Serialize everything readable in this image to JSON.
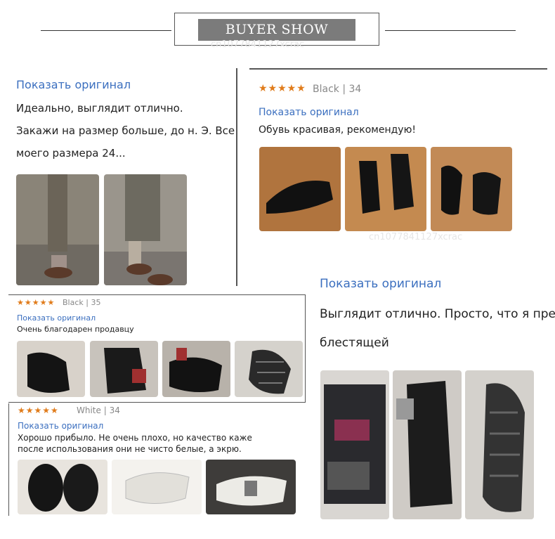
{
  "header": {
    "title": "BUYER SHOW",
    "watermark": "cn1077841127xcrac"
  },
  "review1": {
    "link": "Показать оригинал",
    "line1": "Идеально, выглядит отлично.",
    "line2": "Закажи на размер больше, до н. Э. Все гов",
    "line3": "моего размера 24..."
  },
  "review2": {
    "stars": "★★★★★",
    "meta": "Black | 34",
    "link": "Показать оригинал",
    "text": "Обувь красивая, рекомендую!"
  },
  "review3": {
    "stars": "★★★★★",
    "meta": "Black | 35",
    "link": "Показать оригинал",
    "text": "Очень благодарен продавцу"
  },
  "review4": {
    "stars": "★★★★★",
    "meta": "White | 34",
    "link": "Показать оригинал",
    "line1": "Хорошо прибыло. Не очень плохо, но качество каже",
    "line2": "после использования они не чисто белые, а экрю."
  },
  "review5": {
    "link": "Показать оригинал",
    "line1": "Выглядит отлично. Просто, что я представлял ее виде",
    "line2": "блестящей"
  },
  "colors": {
    "link": "#3b6fbf",
    "stars": "#e07b1a",
    "title_bg": "#7b7b7b"
  }
}
